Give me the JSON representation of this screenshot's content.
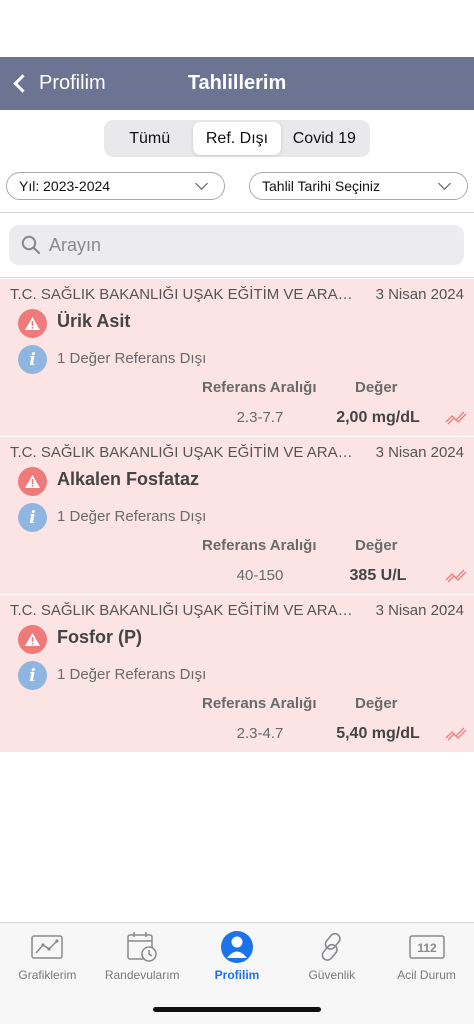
{
  "nav": {
    "back_label": "Profilim",
    "title": "Tahlillerim"
  },
  "segments": [
    {
      "label": "Tümü",
      "active": false
    },
    {
      "label": "Ref. Dışı",
      "active": true
    },
    {
      "label": "Covid 19",
      "active": false
    }
  ],
  "filters": {
    "year_value": "Yıl: 2023-2024",
    "date_value": "Tahlil Tarihi Seçiniz"
  },
  "search": {
    "placeholder": "Arayın"
  },
  "results": [
    {
      "institution": "T.C. SAĞLIK BAKANLIĞI UŞAK EĞİTİM VE ARAŞTIRMA HASTANESİ",
      "date": "3 Nisan 2024",
      "test_name": "Ürik Asit",
      "info": "1 Değer Referans Dışı",
      "ref_label": "Referans Aralığı",
      "value_label": "Değer",
      "ref_range": "2.3-7.7",
      "value": "2,00 mg/dL"
    },
    {
      "institution": "T.C. SAĞLIK BAKANLIĞI UŞAK EĞİTİM VE ARAŞTIRMA HASTANESİ",
      "date": "3 Nisan 2024",
      "test_name": "Alkalen Fosfataz",
      "info": "1 Değer Referans Dışı",
      "ref_label": "Referans Aralığı",
      "value_label": "Değer",
      "ref_range": "40-150",
      "value": "385 U/L"
    },
    {
      "institution": "T.C. SAĞLIK BAKANLIĞI UŞAK EĞİTİM VE ARAŞTIRMA HASTANESİ",
      "date": "3 Nisan 2024",
      "test_name": "Fosfor (P)",
      "info": "1 Değer Referans Dışı",
      "ref_label": "Referans Aralığı",
      "value_label": "Değer",
      "ref_range": "2.3-4.7",
      "value": "5,40 mg/dL"
    }
  ],
  "icons": {
    "warning": "warning-triangle-icon",
    "info": "info-icon",
    "trend": "trend-icon"
  },
  "tabs": [
    {
      "label": "Grafiklerim",
      "icon": "chart-icon",
      "active": false
    },
    {
      "label": "Randevularım",
      "icon": "calendar-clock-icon",
      "active": false
    },
    {
      "label": "Profilim",
      "icon": "profile-icon",
      "active": true
    },
    {
      "label": "Güvenlik",
      "icon": "link-icon",
      "active": false
    },
    {
      "label": "Acil Durum",
      "icon": "emergency-112-icon",
      "active": false
    }
  ],
  "emergency_number": "112",
  "colors": {
    "nav_bg": "#6b7593",
    "card_bg": "#fde4e4",
    "warning": "#ef7a7a",
    "info": "#8fb6e0",
    "active_tab": "#1a73e8"
  }
}
